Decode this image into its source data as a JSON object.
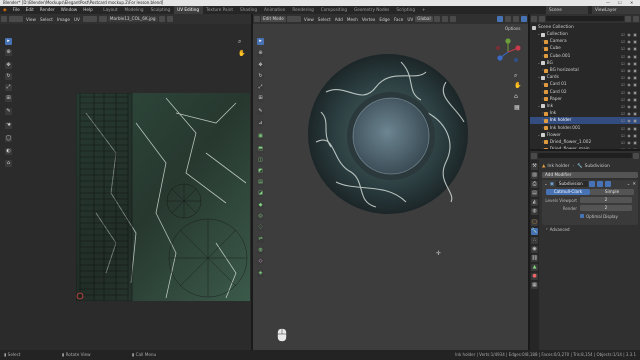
{
  "window": {
    "title": "Blender* [D:\\Blender\\Mockups\\ElegantPost\\Postcard mockup.2\\For lesson.blend]"
  },
  "menu": {
    "items": [
      "File",
      "Edit",
      "Render",
      "Window",
      "Help"
    ],
    "workspaces": [
      "Layout",
      "Modeling",
      "Sculpting",
      "UV Editing",
      "Texture Paint",
      "Shading",
      "Animation",
      "Rendering",
      "Compositing",
      "Geometry Nodes",
      "Scripting"
    ],
    "active_workspace": "UV Editing",
    "scene": "Scene",
    "view_layer": "ViewLayer"
  },
  "uv_editor": {
    "header": [
      "View",
      "Select",
      "Image",
      "UV"
    ],
    "image_name": "Marble13_COL_6K.jpg"
  },
  "viewport": {
    "mode": "Edit Mode",
    "header": [
      "View",
      "Select",
      "Add",
      "Mesh",
      "Vertex",
      "Edge",
      "Face",
      "UV"
    ],
    "orientation": "Global",
    "options_label": "Options"
  },
  "outliner": {
    "title": "Scene Collection",
    "items": [
      {
        "label": "Collection",
        "depth": 1,
        "icon": "collection-icon",
        "selected": false
      },
      {
        "label": "Camera",
        "depth": 2,
        "icon": "camera-icon",
        "selected": false
      },
      {
        "label": "Cube",
        "depth": 2,
        "icon": "mesh-icon",
        "selected": false
      },
      {
        "label": "Cube.001",
        "depth": 2,
        "icon": "mesh-icon",
        "selected": false
      },
      {
        "label": "BG",
        "depth": 1,
        "icon": "collection-icon",
        "selected": false
      },
      {
        "label": "BG horizontal",
        "depth": 2,
        "icon": "mesh-icon",
        "selected": false
      },
      {
        "label": "Cards",
        "depth": 1,
        "icon": "collection-icon",
        "selected": false
      },
      {
        "label": "Card 01",
        "depth": 2,
        "icon": "mesh-icon",
        "selected": false
      },
      {
        "label": "Card 02",
        "depth": 2,
        "icon": "mesh-icon",
        "selected": false
      },
      {
        "label": "Paper",
        "depth": 2,
        "icon": "mesh-icon",
        "selected": false
      },
      {
        "label": "Ink",
        "depth": 1,
        "icon": "collection-icon",
        "selected": false
      },
      {
        "label": "Ink",
        "depth": 2,
        "icon": "mesh-icon",
        "selected": false
      },
      {
        "label": "Ink holder",
        "depth": 2,
        "icon": "mesh-icon",
        "selected": true
      },
      {
        "label": "Ink holder.001",
        "depth": 2,
        "icon": "mesh-icon",
        "selected": false
      },
      {
        "label": "Flower",
        "depth": 1,
        "icon": "collection-icon",
        "selected": false
      },
      {
        "label": "Dried_flower_1.002",
        "depth": 2,
        "icon": "mesh-icon",
        "selected": false
      },
      {
        "label": "Dried_flower_main",
        "depth": 2,
        "icon": "mesh-icon",
        "selected": false
      }
    ]
  },
  "properties": {
    "object_name": "Ink holder",
    "modifier_type": "Subdivision",
    "add_modifier": "Add Modifier",
    "modifier_name": "Subdivision",
    "mode_catmull": "Catmull-Clark",
    "mode_simple": "Simple",
    "levels_label": "Levels Viewport",
    "levels_value": "2",
    "render_label": "Render",
    "render_value": "2",
    "optimal_label": "Optimal Display",
    "advanced_label": "Advanced"
  },
  "status": {
    "select": "Select",
    "rotate": "Rotate View",
    "call_menu": "Call Menu",
    "stats": "Ink holder | Verts:1/4934 | Edges:0/8,188 | Faces:0/3,270 | Tris:8,154 | Objects:1/14 | 3.3.1"
  },
  "colors": {
    "accent": "#4772b3",
    "selection": "#334d80",
    "panel": "#303030",
    "viewport_bg": "#3d3d3d",
    "orange": "#e09a3e"
  }
}
